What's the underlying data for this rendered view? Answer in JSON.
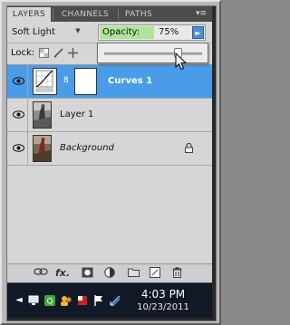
{
  "tabs": [
    {
      "label": "LAYERS",
      "active": true
    },
    {
      "label": "CHANNELS",
      "active": false
    },
    {
      "label": "PATHS",
      "active": false
    }
  ],
  "panel_menu_icon": "panel-menu-arrows",
  "blend_mode": "Soft Light",
  "opacity": {
    "label": "Opacity:",
    "value": "75%",
    "level": 0.75
  },
  "lock": {
    "label": "Lock:"
  },
  "layers": [
    {
      "name": "Curves 1",
      "type": "adjustment",
      "visible": true,
      "selected": true
    },
    {
      "name": "Layer 1",
      "type": "pixel",
      "visible": true,
      "selected": false
    },
    {
      "name": "Background",
      "type": "background",
      "visible": true,
      "selected": false,
      "locked": true
    }
  ],
  "footer_icons": [
    "link-layers-icon",
    "fx-icon",
    "add-mask-icon",
    "adjustment-layer-icon",
    "new-group-icon",
    "new-layer-icon",
    "trash-icon"
  ],
  "fx_label": "fx.",
  "taskbar": {
    "time": "4:03 PM",
    "date": "10/23/2011"
  },
  "colors": {
    "selected_row": "#4a9ce8",
    "opacity_highlight": "#aee59a",
    "taskbar": "#111826"
  }
}
